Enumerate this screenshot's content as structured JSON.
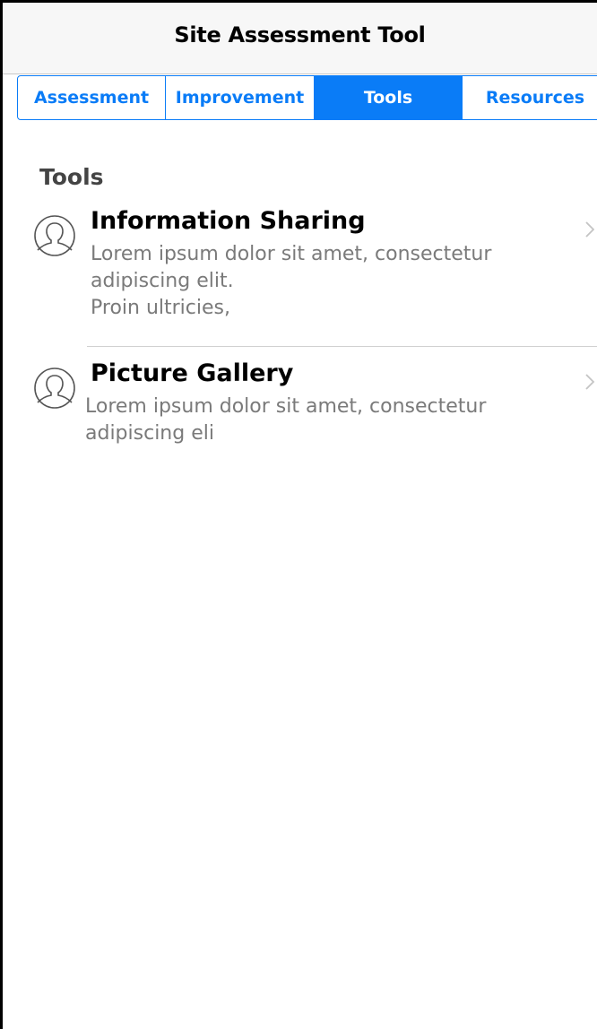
{
  "header": {
    "title": "Site Assessment Tool"
  },
  "tabs": [
    {
      "label": "Assessment",
      "active": false
    },
    {
      "label": "Improvement",
      "active": false
    },
    {
      "label": "Tools",
      "active": true
    },
    {
      "label": "Resources",
      "active": false
    }
  ],
  "section": {
    "title": "Tools"
  },
  "items": [
    {
      "title": "Information Sharing",
      "desc_lines": [
        "Lorem ipsum dolor sit amet, consectetur",
        "adipiscing elit.",
        "Proin ultricies,"
      ],
      "icon": "user-avatar-icon",
      "chevron": "chevron-right-icon"
    },
    {
      "title": "Picture Gallery",
      "desc_lines": [
        "Lorem ipsum dolor sit amet, consectetur",
        "adipiscing eli"
      ],
      "icon": "user-avatar-icon",
      "chevron": "chevron-right-icon"
    }
  ],
  "colors": {
    "accent": "#0a7cf7",
    "header_bg": "#f7f7f7",
    "desc_text": "#7a7a7a"
  }
}
